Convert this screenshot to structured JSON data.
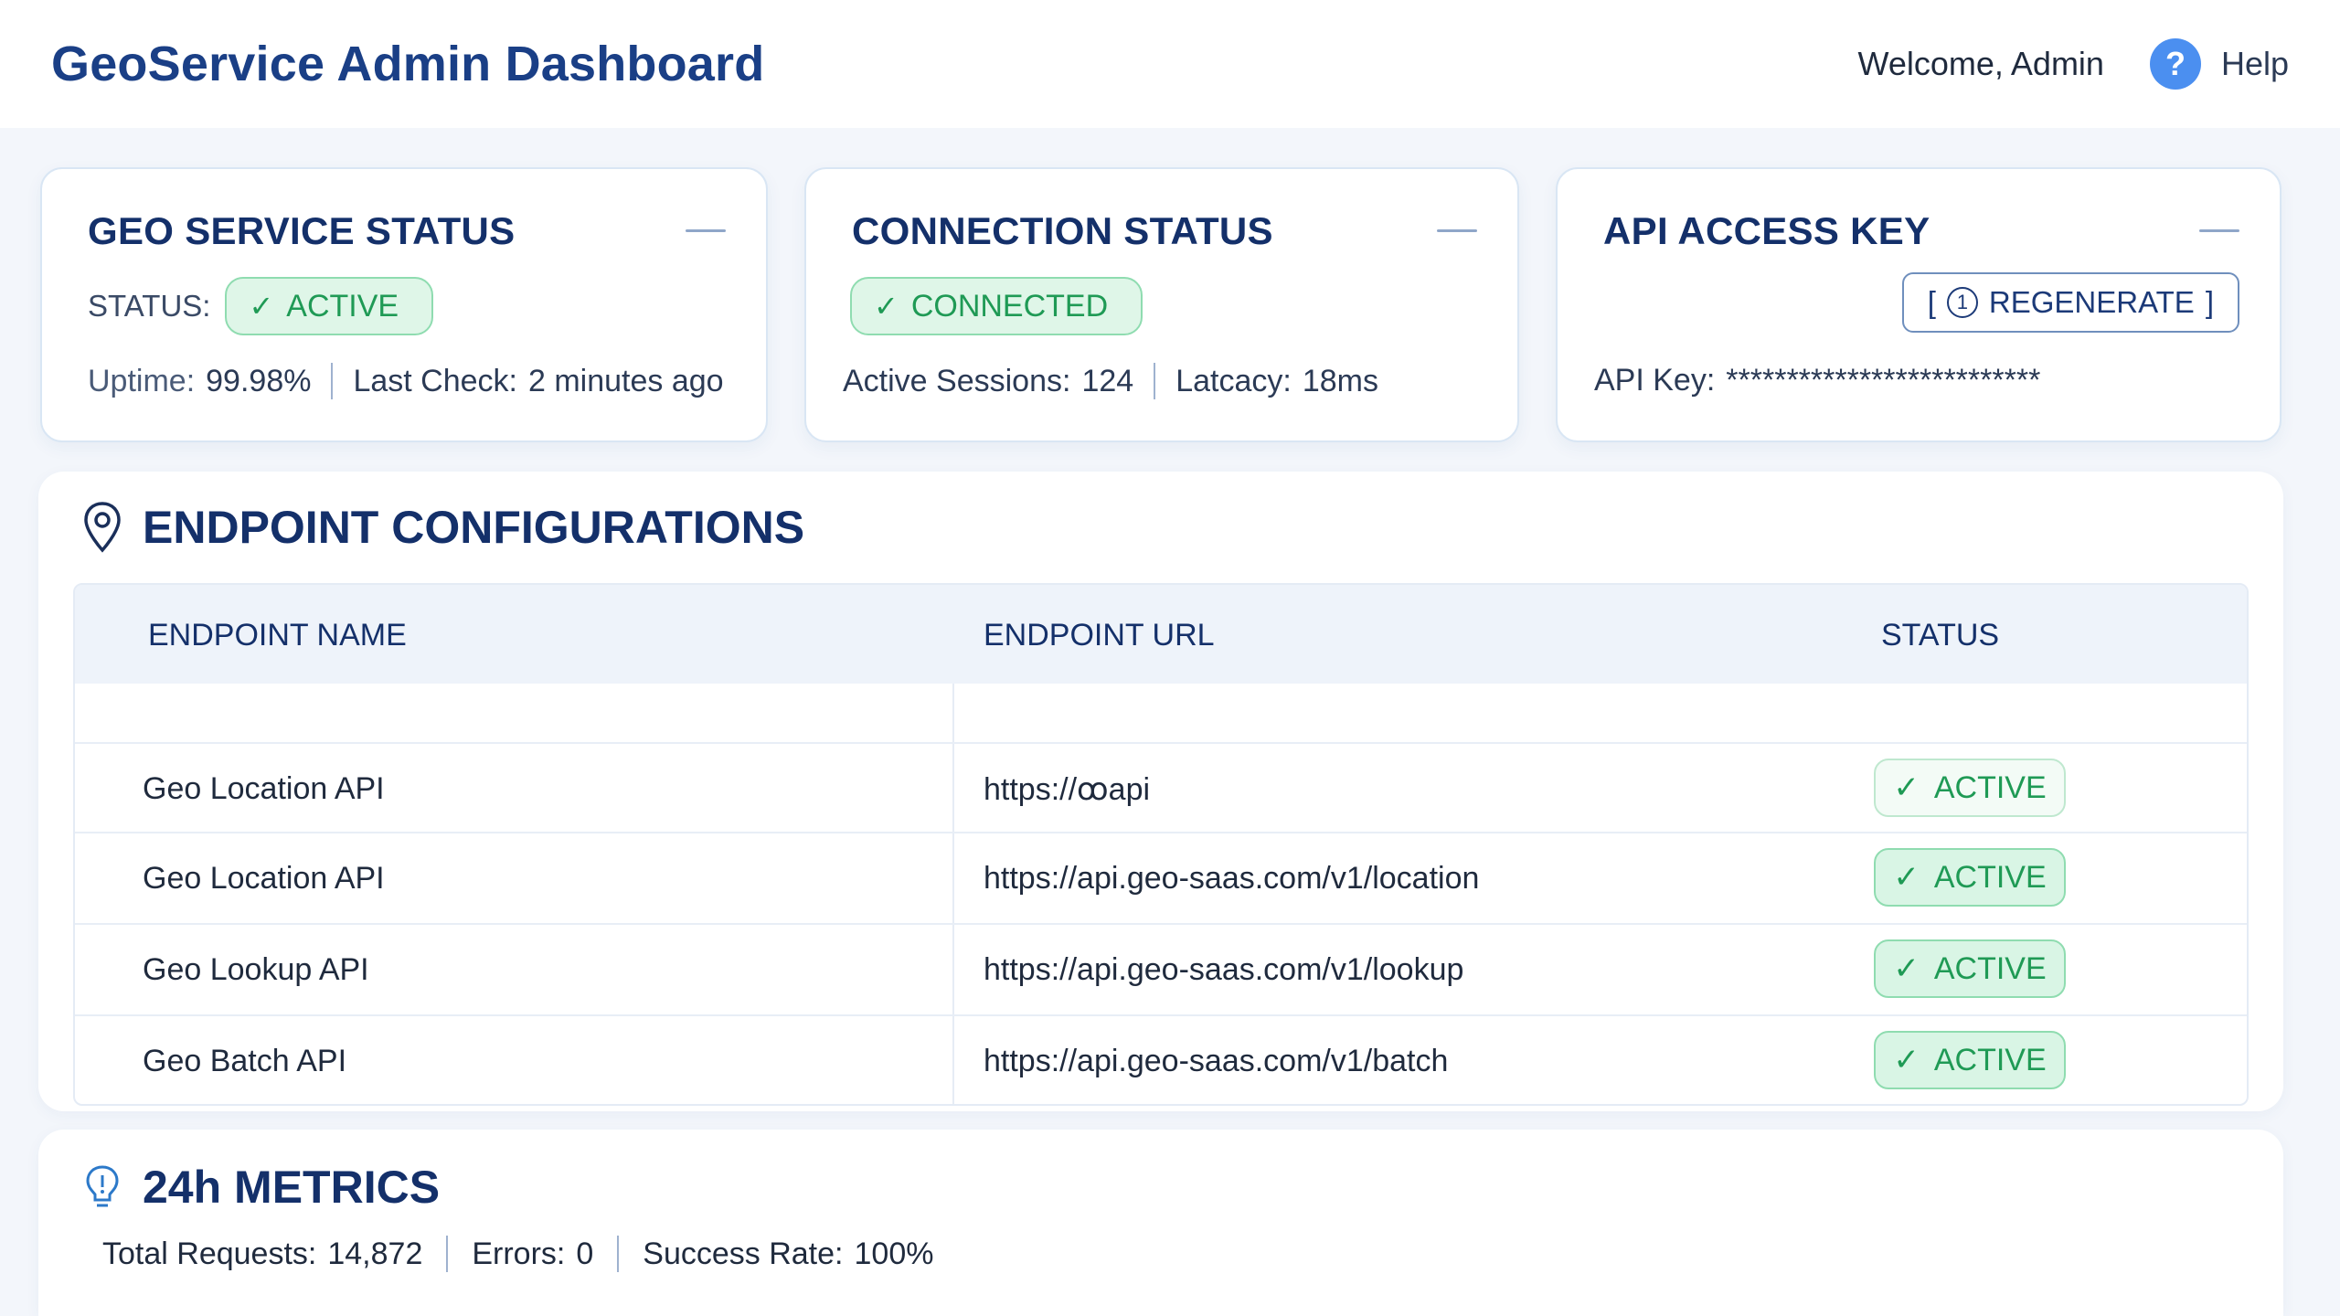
{
  "header": {
    "title": "GeoService Admin Dashboard",
    "welcome": "Welcome, Admin",
    "help_label": "Help",
    "help_glyph": "?"
  },
  "cards": {
    "geo_service": {
      "title": "GEO SERVICE STATUS",
      "status_label": "STATUS:",
      "status_value": "ACTIVE",
      "uptime_label": "Uptime:",
      "uptime_value": "99.98%",
      "last_check_label": "Last Check:",
      "last_check_value": "2 minutes ago"
    },
    "connection": {
      "title": "CONNECTION STATUS",
      "status_value": "CONNECTED",
      "sessions_label": "Active Sessions:",
      "sessions_value": "124",
      "latency_label": "Latcacy:",
      "latency_value": "18ms"
    },
    "api_key": {
      "title": "API ACCESS KEY",
      "regen_open": "[",
      "regen_label": "REGENERATE",
      "regen_close": "]",
      "key_label": "API Key:",
      "key_value": "**************************"
    }
  },
  "endpoints": {
    "title": "ENDPOINT CONFIGURATIONS",
    "columns": [
      "ENDPOINT NAME",
      "ENDPOINT URL",
      "STATUS"
    ],
    "rows": [
      {
        "name": "Geo Location API",
        "url": "https://ꝏapi",
        "status": "ACTIVE"
      },
      {
        "name": "Geo Location API",
        "url": "https://api.geo-saas.com/v1/location",
        "status": "ACTIVE"
      },
      {
        "name": "Geo Lookup API",
        "url": "https://api.geo-saas.com/v1/lookup",
        "status": "ACTIVE"
      },
      {
        "name": "Geo Batch API",
        "url": "https://api.geo-saas.com/v1/batch",
        "status": "ACTIVE"
      }
    ]
  },
  "metrics": {
    "title": "24h METRICS",
    "total_label": "Total Requests:",
    "total_value": "14,872",
    "errors_label": "Errors:",
    "errors_value": "0",
    "success_label": "Success Rate:",
    "success_value": "100%"
  },
  "colors": {
    "brand": "#1a3f86",
    "active_green": "#1f9a55",
    "active_bg": "#dff6e8",
    "help_blue": "#4b8ff0"
  },
  "icons": {
    "status_check": "✓",
    "endpoints": "map-pin-icon",
    "metrics": "lightbulb-icon",
    "regenerate": "key-icon"
  }
}
